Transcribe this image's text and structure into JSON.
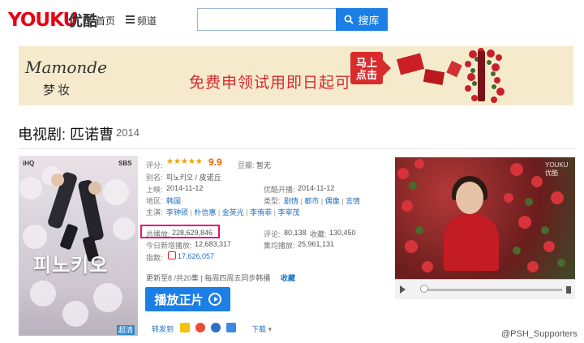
{
  "header": {
    "logo": "YOUKU",
    "logo_cn": "优酷",
    "nav_home": "首页",
    "nav_channels": "频道",
    "search_value": "",
    "search_button": "搜库"
  },
  "ad": {
    "brand": "Mamonde",
    "brand_cn": "梦妆",
    "slogan": "免费申领试用即日起可",
    "badge_line1": "马上",
    "badge_line2": "点击"
  },
  "show": {
    "title": "电视剧: 匹诺曹",
    "year": "2014",
    "poster": {
      "corner_left": "iHQ",
      "corner_right": "SBS",
      "title": "피노키오",
      "hd_badge": "超清"
    },
    "rating_label": "评分:",
    "rating_stars": 4.5,
    "rating_value": "9.9",
    "douban_label": "豆瓣:",
    "douban_value": "暂无",
    "alias_label": "别名:",
    "alias_value": "피노키오 / 皮诺丘",
    "release_label": "上映:",
    "release_value": "2014-11-12",
    "youku_release_label": "优酷开播:",
    "youku_release_value": "2014-11-12",
    "region_label": "地区:",
    "region_value": "韩国",
    "genre_label": "类型:",
    "genres": [
      "剧情",
      "都市",
      "偶像",
      "言情"
    ],
    "cast_label": "主演:",
    "cast": [
      "李钟硕",
      "朴信惠",
      "金英光",
      "李侑菲",
      "李宰茂"
    ],
    "total_plays_label": "总播放:",
    "total_plays_value": "228,629,846",
    "comments_label": "评论:",
    "comments_value": "80,138",
    "favorites_label": "收藏:",
    "favorites_value": "130,450",
    "today_plays_label": "今日新增播放:",
    "today_plays_value": "12,683,317",
    "episode_plays_label": "集均播放:",
    "episode_plays_value": "25,961,131",
    "follow_label": "指数:",
    "follow_value": "17,626,057",
    "update_text": "更新至8 /共20集 | 每周四周五同步韩播",
    "collect_link": "收藏",
    "play_button": "播放正片",
    "share_label": "转发到",
    "download_label": "下载"
  },
  "video": {
    "brand": "YOUKU 优酷"
  },
  "watermark": "@PSH_Supporters",
  "colors": {
    "accent_blue": "#1b7fe5",
    "highlight": "#e5127a",
    "score": "#f06000",
    "ad_bg": "#f5ebcc",
    "ad_red": "#d7292f"
  }
}
